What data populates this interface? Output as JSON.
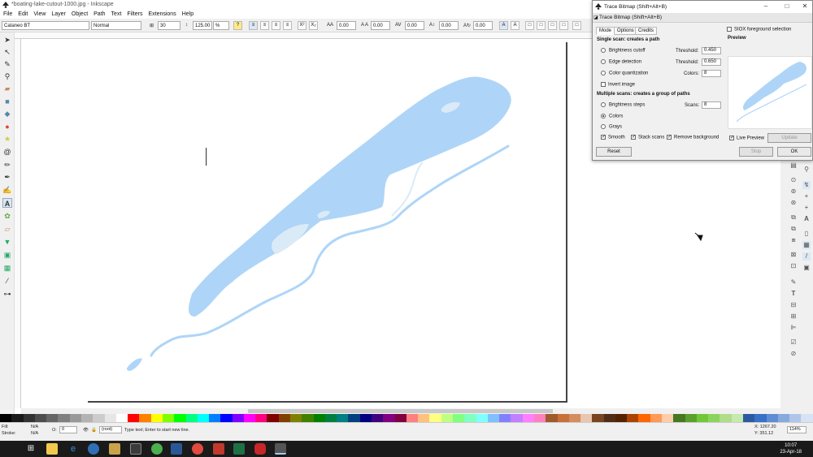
{
  "window": {
    "title": "*boating-lake-cutout-1000.jpg - Inkscape"
  },
  "menu": [
    "File",
    "Edit",
    "View",
    "Layer",
    "Object",
    "Path",
    "Text",
    "Filters",
    "Extensions",
    "Help"
  ],
  "toolbar": {
    "font_family": "Cataneo BT",
    "font_style": "Normal",
    "font_size": "30",
    "line_spacing": "125.00",
    "line_unit": "%",
    "letter_spacing": "0.00",
    "word_spacing": "0.00",
    "kerning": "0.00",
    "vertical_shift": "0.00",
    "rotation": "0.00"
  },
  "dialog": {
    "title": "Trace Bitmap (Shift+Alt+B)",
    "subtitle": "Trace Bitmap (Shift+Alt+B)",
    "tabs": [
      "Mode",
      "Options",
      "Credits"
    ],
    "single_scan_title": "Single scan: creates a path",
    "brightness_cutoff": "Brightness cutoff",
    "edge_detection": "Edge detection",
    "color_quantization": "Color quantization",
    "invert_image": "Invert image",
    "threshold_label": "Threshold:",
    "threshold_1": "0.450",
    "threshold_2": "0.650",
    "colors_label": "Colors:",
    "colors_value": "8",
    "multi_scan_title": "Multiple scans: creates a group of paths",
    "brightness_steps": "Brightness steps",
    "scans_label": "Scans:",
    "scans_value": "8",
    "colors_option": "Colors",
    "grays_option": "Grays",
    "smooth": "Smooth",
    "stack_scans": "Stack scans",
    "remove_background": "Remove background",
    "siox": "SIOX foreground selection",
    "preview_label": "Preview",
    "live_preview": "Live Preview",
    "update": "Update",
    "reset": "Reset",
    "stop": "Stop",
    "ok": "OK"
  },
  "status": {
    "fill_label": "Fill:",
    "fill_value": "N/A",
    "stroke_label": "Stroke:",
    "stroke_value": "N/A",
    "opacity_label": "O:",
    "opacity_value": "0",
    "layer": "(root)",
    "message": "Type text; Enter to start new line.",
    "x_coord": "X: 1267.20",
    "y_coord": "Y: 351.12",
    "zoom": "114%"
  },
  "taskbar": {
    "time": "10:07",
    "date": "23-Apr-18"
  },
  "colors": {
    "lake": "#aed5f7",
    "lake_light": "#dbeaf7",
    "palette": [
      "#000000",
      "#1a1a1a",
      "#333333",
      "#4d4d4d",
      "#666666",
      "#808080",
      "#999999",
      "#b3b3b3",
      "#cccccc",
      "#e6e6e6",
      "#ffffff",
      "#ff0000",
      "#ff8000",
      "#ffff00",
      "#80ff00",
      "#00ff00",
      "#00ff80",
      "#00ffff",
      "#0080ff",
      "#0000ff",
      "#8000ff",
      "#ff00ff",
      "#ff0080",
      "#800000",
      "#804000",
      "#808000",
      "#408000",
      "#008000",
      "#008040",
      "#008080",
      "#004080",
      "#000080",
      "#400080",
      "#800080",
      "#800040",
      "#ff8080",
      "#ffc080",
      "#ffff80",
      "#c0ff80",
      "#80ff80",
      "#80ffc0",
      "#80ffff",
      "#80c0ff",
      "#8080ff",
      "#c080ff",
      "#ff80ff",
      "#ff80c0",
      "#a05a2c",
      "#c87137",
      "#d38d5f",
      "#e9c6af",
      "#784421",
      "#502d16",
      "#552200",
      "#aa4400",
      "#ff6600",
      "#ff9955",
      "#ffccaa",
      "#447821",
      "#5aa02c",
      "#71c837",
      "#8dd35f",
      "#afdd8a",
      "#c6e9af",
      "#2c5aa0",
      "#3771c8",
      "#5f8dd3",
      "#87aade",
      "#afc6e9",
      "#d7e3f4"
    ]
  }
}
